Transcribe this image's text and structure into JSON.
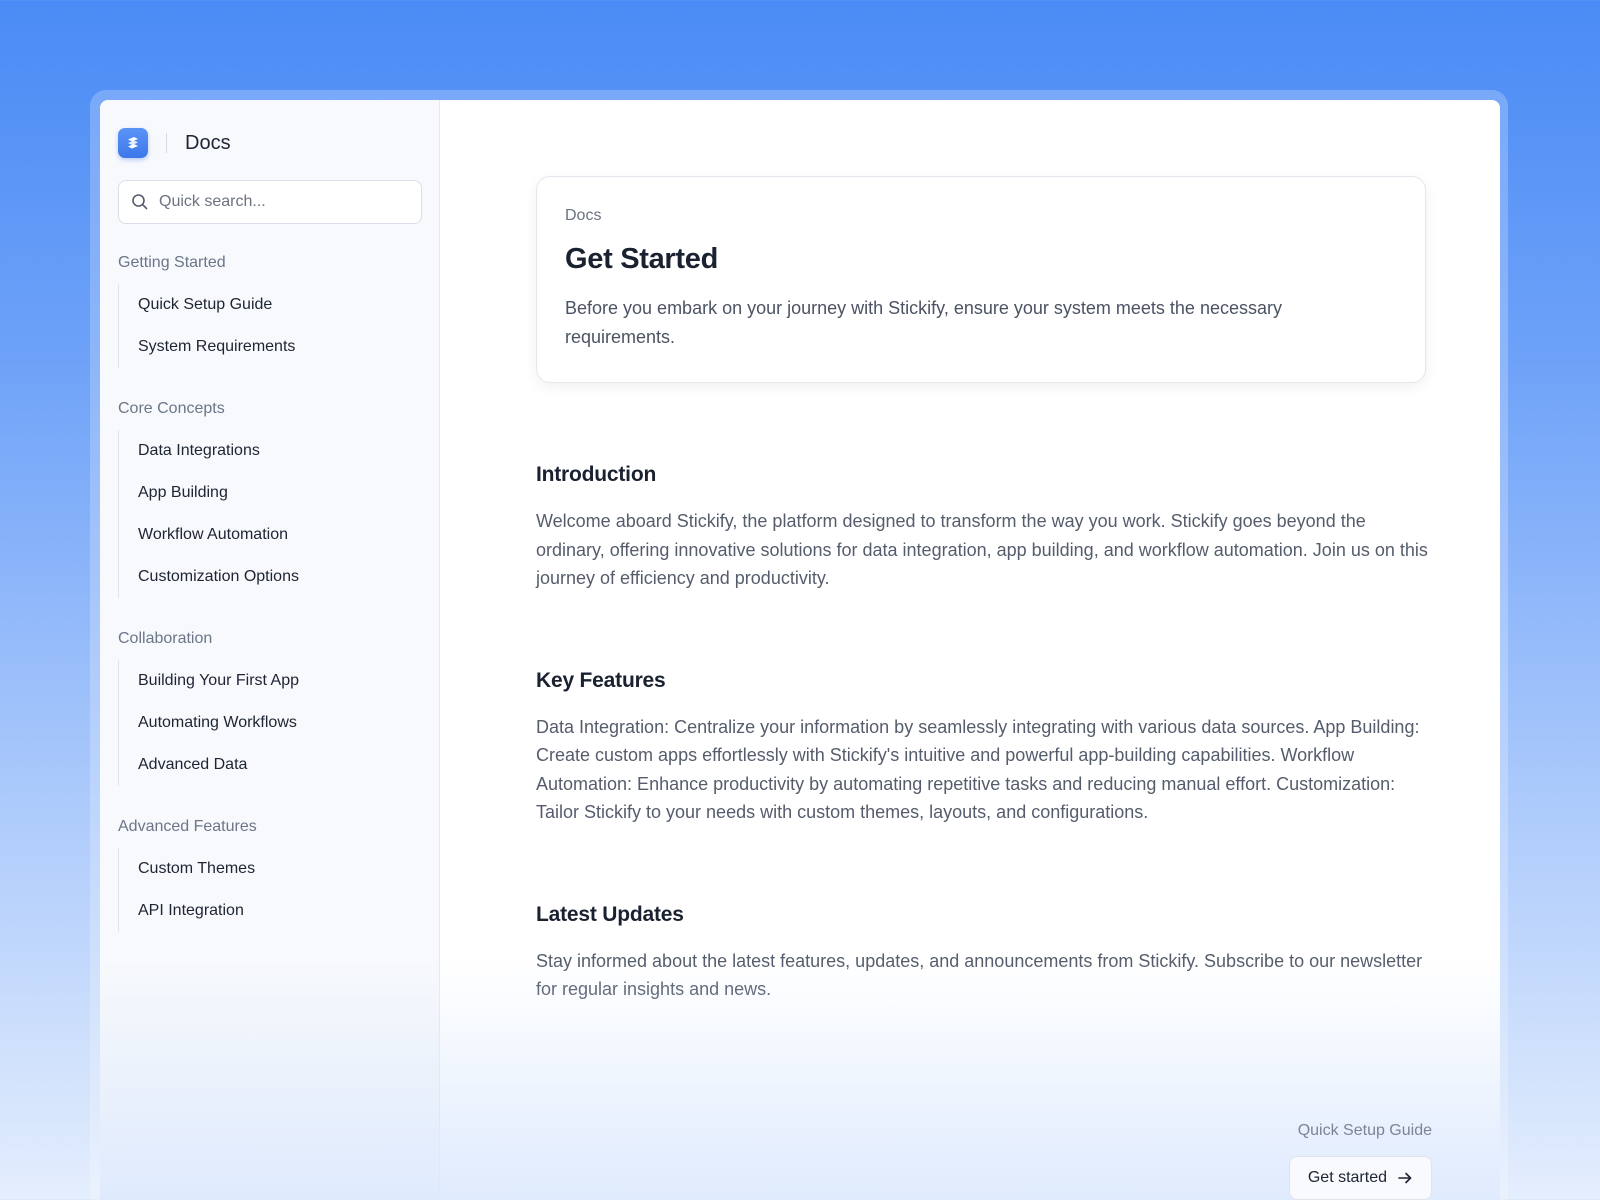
{
  "brand": {
    "title": "Docs",
    "logo_icon": "stickify-logo-icon",
    "accent": "#4a87f4"
  },
  "search": {
    "placeholder": "Quick search..."
  },
  "sidebar": {
    "groups": [
      {
        "title": "Getting Started",
        "items": [
          "Quick Setup Guide",
          "System Requirements"
        ]
      },
      {
        "title": "Core Concepts",
        "items": [
          "Data Integrations",
          "App Building",
          "Workflow Automation",
          "Customization Options"
        ]
      },
      {
        "title": "Collaboration",
        "items": [
          "Building Your First App",
          "Automating Workflows",
          "Advanced Data"
        ]
      },
      {
        "title": "Advanced Features",
        "items": [
          "Custom Themes",
          "API Integration"
        ]
      }
    ]
  },
  "hero": {
    "breadcrumb": "Docs",
    "title": "Get Started",
    "description": "Before you embark on your journey with Stickify, ensure your system meets the necessary requirements."
  },
  "sections": [
    {
      "title": "Introduction",
      "body": "Welcome aboard Stickify, the platform designed to transform the way you work. Stickify goes beyond the ordinary, offering innovative solutions for data integration, app building, and workflow automation. Join us on this journey of efficiency and productivity."
    },
    {
      "title": "Key Features",
      "body": "Data Integration: Centralize your information by seamlessly integrating with various data sources.  App Building: Create custom apps effortlessly with Stickify's intuitive and powerful app-building capabilities. Workflow Automation: Enhance productivity by automating repetitive tasks and reducing manual effort. Customization: Tailor Stickify to your needs with custom themes, layouts, and configurations."
    },
    {
      "title": "Latest Updates",
      "body": "Stay informed about the latest features, updates, and announcements from Stickify. Subscribe to our newsletter for regular insights and news."
    }
  ],
  "footer": {
    "next_label": "Quick Setup Guide",
    "button_label": "Get started",
    "button_icon": "arrow-right-icon"
  }
}
